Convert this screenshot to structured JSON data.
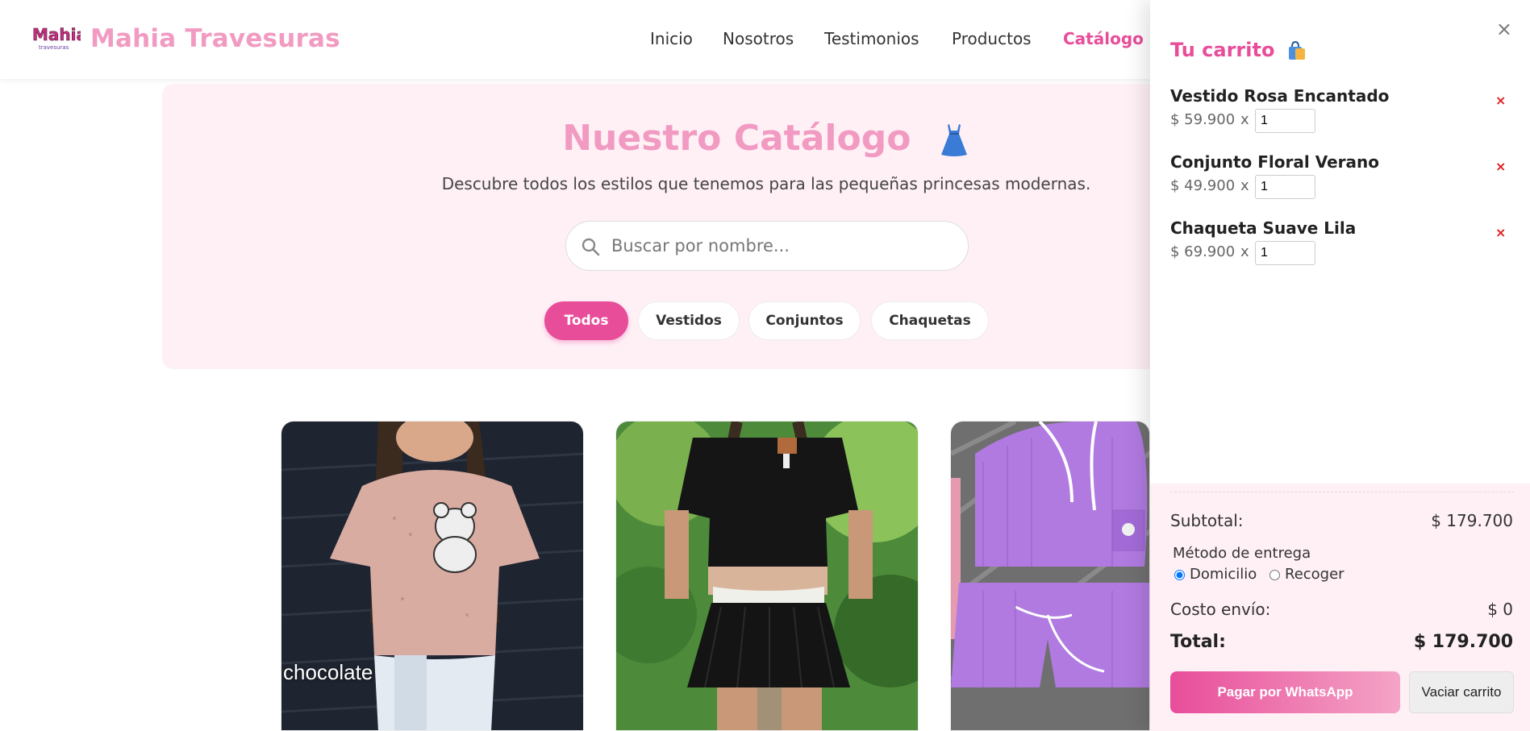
{
  "header": {
    "brand": "Mahia Travesuras",
    "logo_text": "Mahia",
    "nav": [
      "Inicio",
      "Nosotros",
      "Testimonios",
      "Productos",
      "Catálogo"
    ],
    "active_nav": "Catálogo",
    "accent_color": "#e84d9a",
    "brand_color": "#f29bc2"
  },
  "hero": {
    "title": "Nuestro Catálogo",
    "title_icon": "dress-icon",
    "subtitle": "Descubre todos los estilos que tenemos para las pequeñas princesas modernas.",
    "search_placeholder": "Buscar por nombre...",
    "search_value": "",
    "filters": [
      "Todos",
      "Vestidos",
      "Conjuntos",
      "Chaquetas"
    ],
    "active_filter": "Todos"
  },
  "products": [
    {
      "image": "pink-mesh-top-photo",
      "label": "chocolate"
    },
    {
      "image": "black-crop-skirt-photo",
      "label": ""
    },
    {
      "image": "lilac-hoodie-set-photo",
      "label": ""
    }
  ],
  "cart": {
    "title": "Tu carrito",
    "title_icon": "shopping-bag-icon",
    "close_label": "×",
    "items": [
      {
        "name": "Vestido Rosa Encantado",
        "price": "$ 59.900",
        "times": "x",
        "qty": "1",
        "remove": "×"
      },
      {
        "name": "Conjunto Floral Verano",
        "price": "$ 49.900",
        "times": "x",
        "qty": "1",
        "remove": "×"
      },
      {
        "name": "Chaqueta Suave Lila",
        "price": "$ 69.900",
        "times": "x",
        "qty": "1",
        "remove": "×"
      }
    ],
    "subtotal_label": "Subtotal:",
    "subtotal_value": "$ 179.700",
    "delivery_method_label": "Método de entrega",
    "delivery_options": [
      "Domicilio",
      "Recoger"
    ],
    "delivery_selected": "Domicilio",
    "shipping_label": "Costo envío:",
    "shipping_value": "$ 0",
    "total_label": "Total:",
    "total_value": "$ 179.700",
    "pay_button": "Pagar por WhatsApp",
    "clear_button": "Vaciar carrito"
  }
}
